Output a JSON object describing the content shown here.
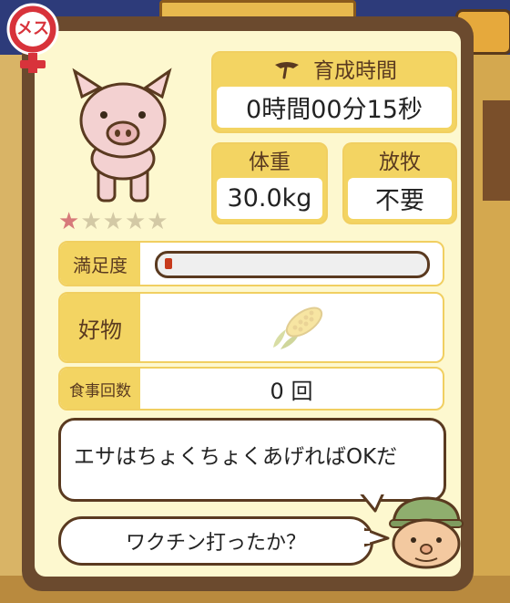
{
  "pig": {
    "gender_label": "メス",
    "rarity_stars": 1,
    "rarity_max": 5
  },
  "stats": {
    "time_label": "育成時間",
    "time_value": "0時間00分15秒",
    "weight_label": "体重",
    "weight_value": "30.0kg",
    "grazing_label": "放牧",
    "grazing_value": "不要"
  },
  "satisfaction": {
    "label": "満足度",
    "level": 0.02
  },
  "favorite": {
    "label": "好物",
    "food_icon": "corn-icon"
  },
  "meals": {
    "label": "食事回数",
    "value": "0 回"
  },
  "dialogue": {
    "tip": "エサはちょくちょくあげればOKだ",
    "question": "ワクチン打ったか？"
  },
  "colors": {
    "panel_border": "#6b4a2e",
    "panel_bg": "#fdf8cf",
    "label_bg": "#f3d462",
    "female_badge": "#d8333b",
    "bar_fill": "#c73a1c"
  }
}
